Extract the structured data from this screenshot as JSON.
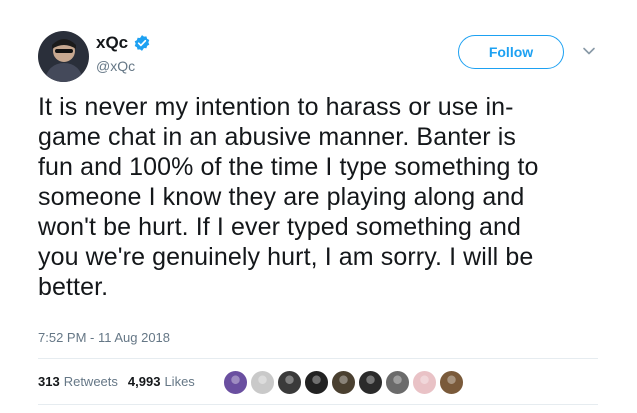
{
  "author": {
    "name": "xQc",
    "handle": "@xQc",
    "verified": true,
    "avatar_icon": "profile-photo"
  },
  "follow_button": {
    "label": "Follow"
  },
  "menu_icon": "chevron-down-icon",
  "tweet": {
    "text": "It is never my intention to harass or use in-game chat in an abusive manner. Banter is fun and 100% of the time I type something to someone I know they are playing along and won't be hurt. If I ever typed something and you we're genuinely hurt, I am sorry. I will be better.",
    "lines": [
      "It is never my intention to harass or use in-",
      "game chat in an abusive manner. Banter is",
      "fun and 100% of the time I type something to",
      "someone I know they are playing along and",
      "won't be hurt. If I ever typed something and",
      "you we're genuinely hurt, I am sorry. I will be",
      "better."
    ],
    "timestamp": "7:52 PM - 11 Aug 2018"
  },
  "stats": {
    "retweets_count": "313",
    "retweets_label": "Retweets",
    "likes_count": "4,993",
    "likes_label": "Likes"
  },
  "likers": [
    {
      "color": "#6a4fa0"
    },
    {
      "color": "#c9c9c9"
    },
    {
      "color": "#3a3a3a"
    },
    {
      "color": "#222222"
    },
    {
      "color": "#4a4030"
    },
    {
      "color": "#2b2b2b"
    },
    {
      "color": "#6b6b6b"
    },
    {
      "color": "#e9c2c6"
    },
    {
      "color": "#7a5a3a"
    }
  ],
  "colors": {
    "accent": "#1da1f2",
    "text": "#14171a",
    "muted": "#657786",
    "divider": "#e6ecf0"
  }
}
